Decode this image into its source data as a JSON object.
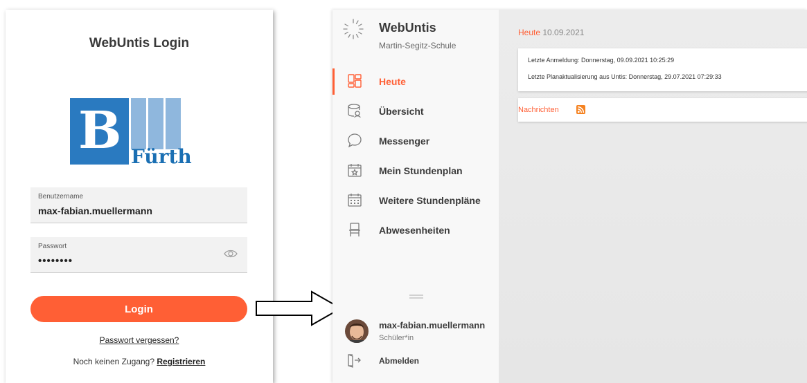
{
  "login": {
    "title": "WebUntis Login",
    "logo": {
      "letter": "B",
      "text": "Fürth"
    },
    "username": {
      "label": "Benutzername",
      "value": "max-fabian.muellermann"
    },
    "password": {
      "label": "Passwort",
      "value": "••••••••"
    },
    "login_button": "Login",
    "forgot_link": "Passwort vergessen?",
    "no_access_text": "Noch keinen Zugang?",
    "register_link": "Registrieren"
  },
  "app": {
    "brand_name": "WebUntis",
    "school_name": "Martin-Segitz-Schule",
    "nav": [
      {
        "label": "Heute",
        "icon": "dashboard-icon",
        "active": true
      },
      {
        "label": "Übersicht",
        "icon": "overview-icon",
        "active": false
      },
      {
        "label": "Messenger",
        "icon": "chat-bubble-icon",
        "active": false
      },
      {
        "label": "Mein Stundenplan",
        "icon": "calendar-star-icon",
        "active": false
      },
      {
        "label": "Weitere Stundenpläne",
        "icon": "calendar-grid-icon",
        "active": false
      },
      {
        "label": "Abwesenheiten",
        "icon": "chair-icon",
        "active": false
      }
    ],
    "user": {
      "name": "max-fabian.muellermann",
      "role": "Schüler*in"
    },
    "logout_label": "Abmelden"
  },
  "main": {
    "today_label": "Heute",
    "today_date": "10.09.2021",
    "last_login": "Letzte Anmeldung: Donnerstag, 09.09.2021 10:25:29",
    "last_update": "Letzte Planaktualisierung aus Untis: Donnerstag, 29.07.2021 07:29:33",
    "news_label": "Nachrichten"
  },
  "colors": {
    "accent": "#ff5f35",
    "logo_blue": "#1a6fb3"
  }
}
